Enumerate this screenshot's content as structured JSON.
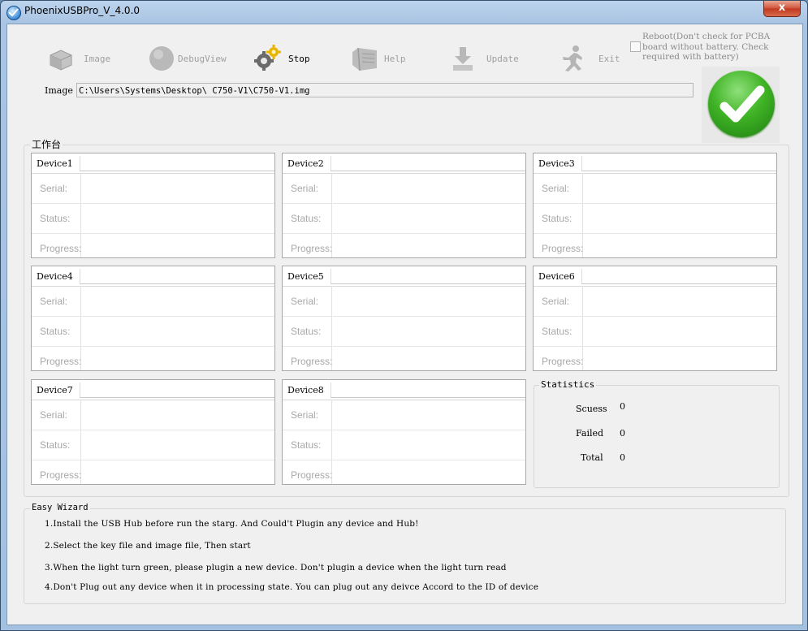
{
  "window": {
    "title": "PhoenixUSBPro_V_4.0.0",
    "close_label": "x"
  },
  "toolbar": {
    "image_label": "Image",
    "debugview_label": "DebugView",
    "stop_label": "Stop",
    "help_label": "Help",
    "update_label": "Update",
    "exit_label": "Exit"
  },
  "reboot": {
    "label": "Reboot(Don't check for PCBA board without battery. Check required with battery)",
    "checked": false
  },
  "image_path": {
    "label": "Image",
    "value": "C:\\Users\\Systems\\Desktop\\ C750-V1\\C750-V1.img"
  },
  "workbench": {
    "title": "工作台",
    "row_labels": {
      "serial": "Serial:",
      "status": "Status:",
      "progress": "Progress:"
    },
    "devices": [
      {
        "name": "Device1"
      },
      {
        "name": "Device2"
      },
      {
        "name": "Device3"
      },
      {
        "name": "Device4"
      },
      {
        "name": "Device5"
      },
      {
        "name": "Device6"
      },
      {
        "name": "Device7"
      },
      {
        "name": "Device8"
      }
    ]
  },
  "statistics": {
    "title": "Statistics",
    "success_label": "Scuess",
    "success_value": "0",
    "failed_label": "Failed",
    "failed_value": "0",
    "total_label": "Total",
    "total_value": "0"
  },
  "wizard": {
    "title": "Easy Wizard",
    "lines": [
      "1.Install the USB Hub before run the starg. And Could't Plugin any device and Hub!",
      "2.Select the key file and image file, Then start",
      "3.When the light turn green, please plugin a new device. Don't plugin a device when the light turn read",
      "4.Don't Plug out any device when it in processing state. You can plug out any deivce Accord to the ID of device"
    ]
  },
  "colors": {
    "status_light": "#2f9e1f",
    "title_bar": "#a9c4e3"
  }
}
